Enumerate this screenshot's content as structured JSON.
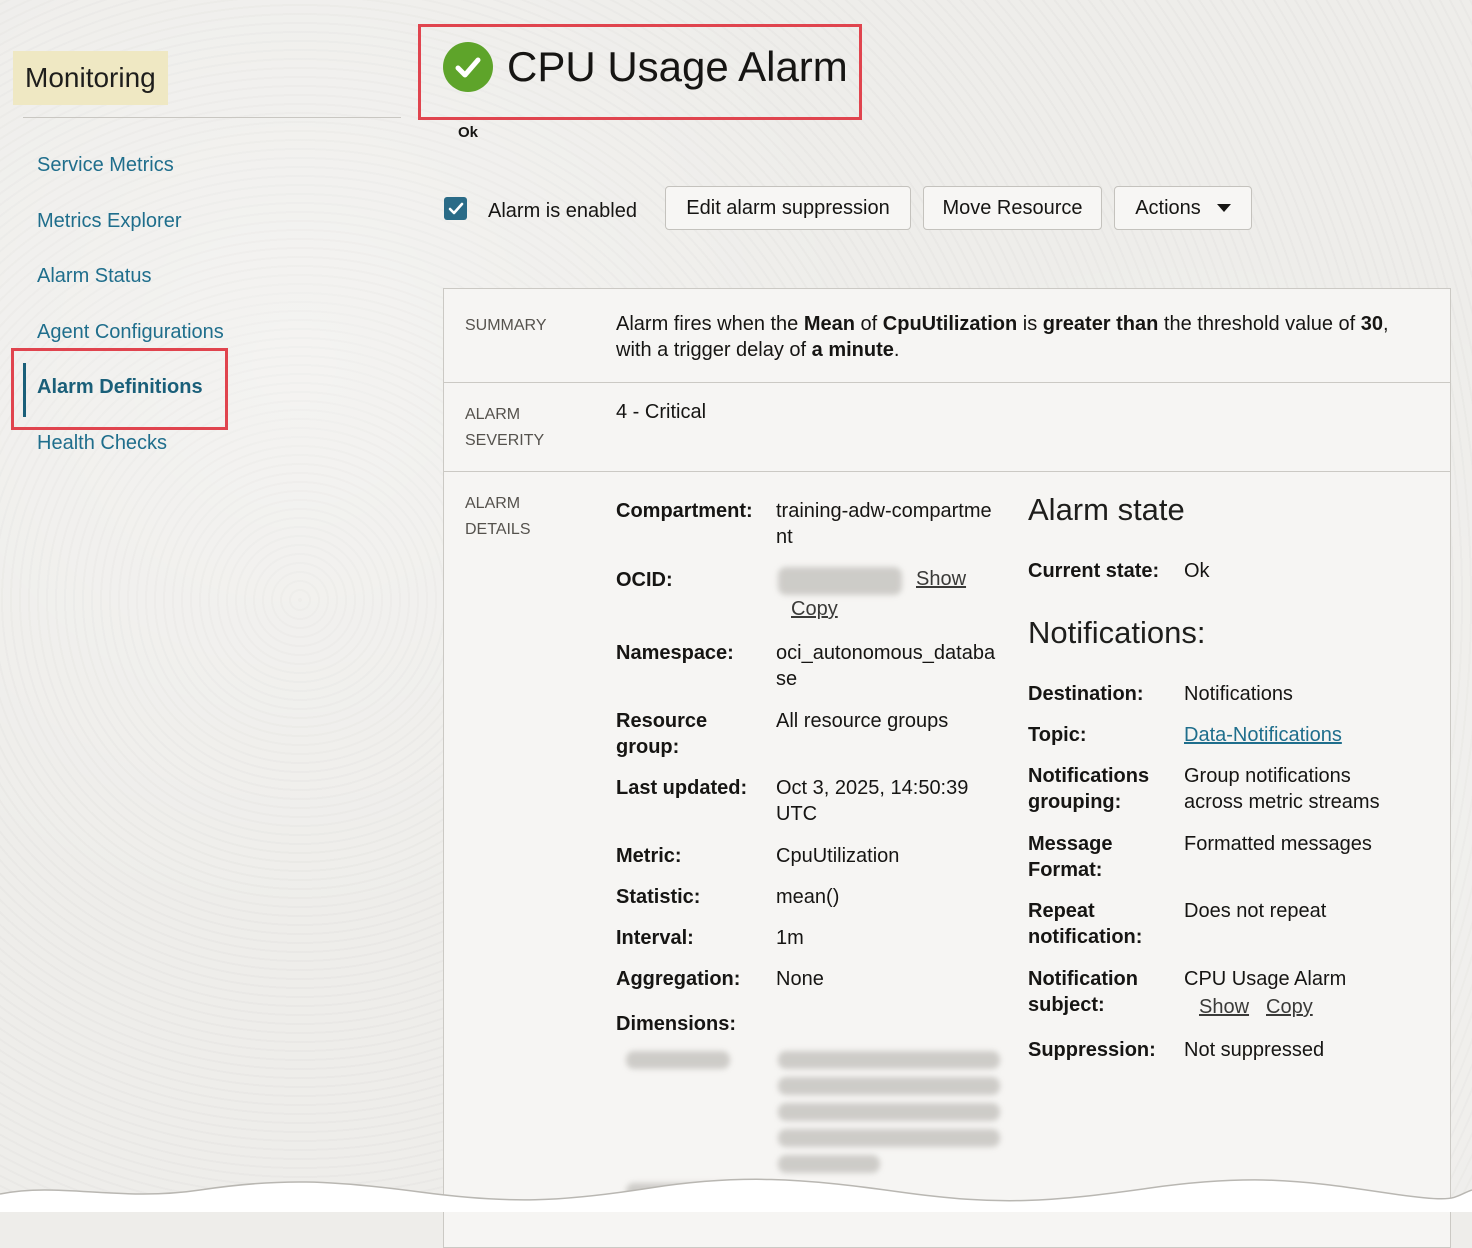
{
  "sidebar": {
    "title": "Monitoring",
    "items": [
      {
        "label": "Service Metrics"
      },
      {
        "label": "Metrics Explorer"
      },
      {
        "label": "Alarm Status"
      },
      {
        "label": "Agent Configurations"
      },
      {
        "label": "Alarm Definitions",
        "active": true
      },
      {
        "label": "Health Checks"
      }
    ]
  },
  "header": {
    "title": "CPU Usage Alarm",
    "state": "Ok",
    "icon": "check-circle-icon"
  },
  "toolbar": {
    "enabled_label": "Alarm is enabled",
    "enabled": true,
    "edit_suppression_label": "Edit alarm suppression",
    "move_resource_label": "Move Resource",
    "actions_label": "Actions"
  },
  "summary": {
    "label": "SUMMARY",
    "parts": [
      "Alarm fires when the ",
      "Mean",
      " of ",
      "CpuUtilization",
      " is ",
      "greater than",
      " the threshold value of ",
      "30",
      ",",
      "with a trigger delay of ",
      "a minute",
      "."
    ]
  },
  "severity": {
    "label1": "ALARM",
    "label2": "SEVERITY",
    "value": "4 - Critical"
  },
  "details": {
    "label1": "ALARM",
    "label2": "DETAILS",
    "compartment_key": "Compartment:",
    "compartment_line1": "training-adw-compartme",
    "compartment_line2": "nt",
    "ocid_key": "OCID:",
    "show": "Show",
    "copy": "Copy",
    "namespace_key": "Namespace:",
    "namespace_line1": "oci_autonomous_databa",
    "namespace_line2": "se",
    "resource_group_key1": "Resource",
    "resource_group_key2": "group:",
    "resource_group_value": "All resource groups",
    "last_updated_key": "Last updated:",
    "last_updated_line1": "Oct 3, 2025, 14:50:39",
    "last_updated_line2": "UTC",
    "metric_key": "Metric:",
    "metric_value": "CpuUtilization",
    "statistic_key": "Statistic:",
    "statistic_value": "mean()",
    "interval_key": "Interval:",
    "interval_value": "1m",
    "aggregation_key": "Aggregation:",
    "aggregation_value": "None",
    "dimensions_key": "Dimensions:"
  },
  "alarm_state": {
    "heading": "Alarm state",
    "current_state_key": "Current state:",
    "current_state_value": "Ok"
  },
  "notifications": {
    "heading": "Notifications:",
    "destination_key": "Destination:",
    "destination_value": "Notifications",
    "topic_key": "Topic:",
    "topic_value": "Data-Notifications",
    "grouping_key1": "Notifications",
    "grouping_key2": "grouping:",
    "grouping_line1": "Group notifications",
    "grouping_line2": "across metric streams",
    "format_key1": "Message",
    "format_key2": "Format:",
    "format_value": "Formatted messages",
    "repeat_key1": "Repeat",
    "repeat_key2": "notification:",
    "repeat_value": "Does not repeat",
    "subject_key1": "Notification",
    "subject_key2": "subject:",
    "subject_value": "CPU Usage Alarm",
    "subject_show": "Show",
    "subject_copy": "Copy",
    "suppression_key": "Suppression:",
    "suppression_value": "Not suppressed"
  },
  "colors": {
    "accent": "#1f6e8c",
    "ok_green": "#5ea42a",
    "highlight_red": "#e0444e",
    "title_bg": "#efe8c3"
  }
}
